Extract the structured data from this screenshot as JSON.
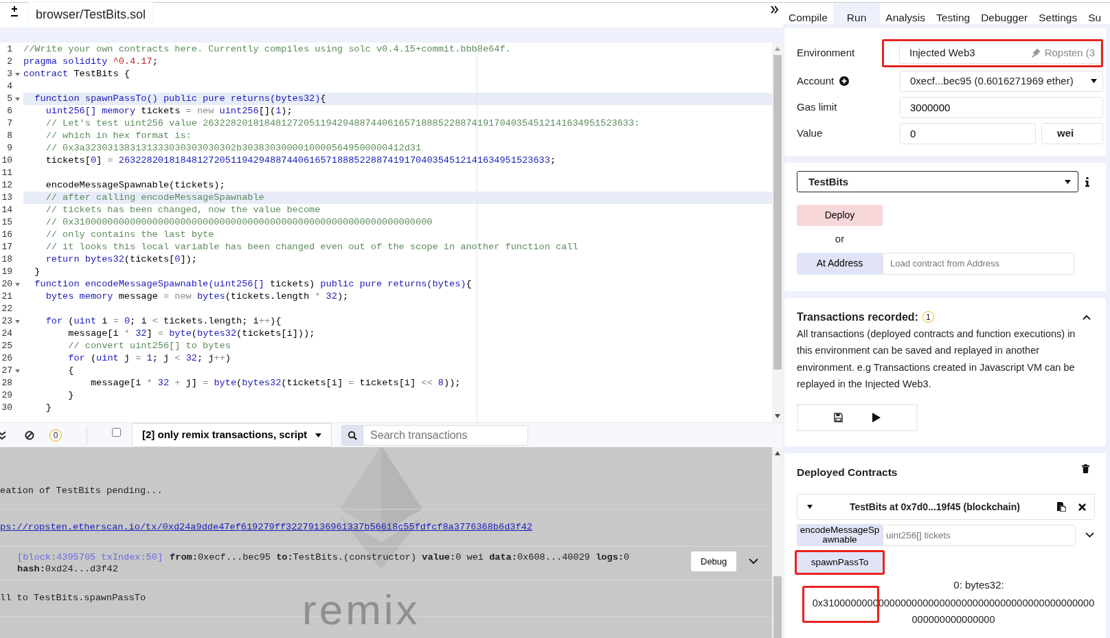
{
  "editor": {
    "tabs": [
      {
        "label": "browser/TestBits.sol",
        "selected": true
      }
    ],
    "lines": [
      {
        "number": "1",
        "fold": false,
        "highlighted": false,
        "tokens": [
          {
            "kind": "comment",
            "t": "//Write your own contracts here. Currently compiles using solc v0.4.15+commit.bbb8e64f."
          }
        ]
      },
      {
        "number": "2",
        "fold": false,
        "highlighted": false,
        "tokens": [
          {
            "kind": "keyword",
            "t": "pragma solidity "
          },
          {
            "kind": "string",
            "t": "^0.4.17"
          },
          {
            "kind": "plain",
            "t": ";"
          }
        ]
      },
      {
        "number": "3",
        "fold": true,
        "highlighted": false,
        "tokens": [
          {
            "kind": "keyword",
            "t": "contract"
          },
          {
            "kind": "plain",
            "t": " TestBits {"
          }
        ]
      },
      {
        "number": "4",
        "fold": false,
        "highlighted": false
      },
      {
        "number": "5",
        "fold": true,
        "highlighted": true,
        "tokens": [
          {
            "kind": "keyword",
            "t": "  function spawnPassTo() public pure returns(bytes32)"
          },
          {
            "kind": "plain",
            "t": "{"
          }
        ]
      },
      {
        "number": "6",
        "fold": false,
        "highlighted": false,
        "tokens": [
          {
            "kind": "keyword",
            "t": "    uint256[] memory"
          },
          {
            "kind": "plain",
            "t": " tickets "
          },
          {
            "kind": "operator",
            "t": "= new "
          },
          {
            "kind": "keyword",
            "t": "uint256"
          },
          {
            "kind": "plain",
            "t": "[]("
          },
          {
            "kind": "number",
            "t": "1"
          },
          {
            "kind": "plain",
            "t": ");"
          }
        ]
      },
      {
        "number": "7",
        "fold": false,
        "highlighted": false,
        "tokens": [
          {
            "kind": "comment",
            "t": "    // Let's test uint256 value 26322820181848127205119429488744061657188852288741917040354512141634951523633:"
          }
        ]
      },
      {
        "number": "8",
        "fold": false,
        "highlighted": false,
        "tokens": [
          {
            "kind": "comment",
            "t": "    // which in hex format is:"
          }
        ]
      },
      {
        "number": "9",
        "fold": false,
        "highlighted": false,
        "tokens": [
          {
            "kind": "comment",
            "t": "    // 0x3a323031383131333030303030302b30383030000100005649500000412d31"
          }
        ]
      },
      {
        "number": "10",
        "fold": false,
        "highlighted": false,
        "tokens": [
          {
            "kind": "plain",
            "t": "    tickets["
          },
          {
            "kind": "number",
            "t": "0"
          },
          {
            "kind": "plain",
            "t": "] "
          },
          {
            "kind": "operator",
            "t": "= "
          },
          {
            "kind": "number",
            "t": "26322820181848127205119429488744061657188852288741917040354512141634951523633"
          },
          {
            "kind": "plain",
            "t": ";"
          }
        ]
      },
      {
        "number": "11",
        "fold": false,
        "highlighted": false
      },
      {
        "number": "12",
        "fold": false,
        "highlighted": false,
        "tokens": [
          {
            "kind": "plain",
            "t": "    encodeMessageSpawnable(tickets);"
          }
        ]
      },
      {
        "number": "13",
        "fold": false,
        "highlighted": true,
        "tokens": [
          {
            "kind": "comment",
            "t": "    // after calling encodeMessageSpawnable"
          }
        ]
      },
      {
        "number": "14",
        "fold": false,
        "highlighted": false,
        "tokens": [
          {
            "kind": "comment",
            "t": "    // tickets has been changed, now the value become"
          }
        ]
      },
      {
        "number": "15",
        "fold": false,
        "highlighted": false,
        "tokens": [
          {
            "kind": "comment",
            "t": "    // 0x3100000000000000000000000000000000000000000000000000000000000000"
          }
        ]
      },
      {
        "number": "16",
        "fold": false,
        "highlighted": false,
        "tokens": [
          {
            "kind": "comment",
            "t": "    // only contains the last byte"
          }
        ]
      },
      {
        "number": "17",
        "fold": false,
        "highlighted": false,
        "tokens": [
          {
            "kind": "comment",
            "t": "    // it looks this local variable has been changed even out of the scope in another function call"
          }
        ]
      },
      {
        "number": "18",
        "fold": false,
        "highlighted": false,
        "tokens": [
          {
            "kind": "keyword",
            "t": "    return bytes32"
          },
          {
            "kind": "plain",
            "t": "(tickets["
          },
          {
            "kind": "number",
            "t": "0"
          },
          {
            "kind": "plain",
            "t": "]);"
          }
        ]
      },
      {
        "number": "19",
        "fold": false,
        "highlighted": false,
        "tokens": [
          {
            "kind": "plain",
            "t": "  }"
          }
        ]
      },
      {
        "number": "20",
        "fold": true,
        "highlighted": false,
        "tokens": [
          {
            "kind": "keyword",
            "t": "  function encodeMessageSpawnable(uint256[]"
          },
          {
            "kind": "plain",
            "t": " tickets) "
          },
          {
            "kind": "keyword",
            "t": "public pure returns(bytes)"
          },
          {
            "kind": "plain",
            "t": "{"
          }
        ]
      },
      {
        "number": "21",
        "fold": false,
        "highlighted": false,
        "tokens": [
          {
            "kind": "keyword",
            "t": "    bytes memory"
          },
          {
            "kind": "plain",
            "t": " message "
          },
          {
            "kind": "operator",
            "t": "= new "
          },
          {
            "kind": "keyword",
            "t": "bytes"
          },
          {
            "kind": "plain",
            "t": "(tickets.length "
          },
          {
            "kind": "operator",
            "t": "* "
          },
          {
            "kind": "number",
            "t": "32"
          },
          {
            "kind": "plain",
            "t": ");"
          }
        ]
      },
      {
        "number": "22",
        "fold": false,
        "highlighted": false
      },
      {
        "number": "23",
        "fold": true,
        "highlighted": false,
        "tokens": [
          {
            "kind": "keyword",
            "t": "    for"
          },
          {
            "kind": "plain",
            "t": " ("
          },
          {
            "kind": "keyword",
            "t": "uint"
          },
          {
            "kind": "plain",
            "t": " i "
          },
          {
            "kind": "operator",
            "t": "= "
          },
          {
            "kind": "number",
            "t": "0"
          },
          {
            "kind": "plain",
            "t": "; i "
          },
          {
            "kind": "operator",
            "t": "< "
          },
          {
            "kind": "plain",
            "t": "tickets.length; i"
          },
          {
            "kind": "operator",
            "t": "++"
          },
          {
            "kind": "plain",
            "t": "){"
          }
        ]
      },
      {
        "number": "24",
        "fold": false,
        "highlighted": false,
        "tokens": [
          {
            "kind": "plain",
            "t": "        message[i "
          },
          {
            "kind": "operator",
            "t": "* "
          },
          {
            "kind": "number",
            "t": "32"
          },
          {
            "kind": "plain",
            "t": "] "
          },
          {
            "kind": "operator",
            "t": "= "
          },
          {
            "kind": "keyword",
            "t": "byte"
          },
          {
            "kind": "plain",
            "t": "("
          },
          {
            "kind": "keyword",
            "t": "bytes32"
          },
          {
            "kind": "plain",
            "t": "(tickets[i]));"
          }
        ]
      },
      {
        "number": "25",
        "fold": false,
        "highlighted": false,
        "tokens": [
          {
            "kind": "comment",
            "t": "        // convert uint256[] to bytes"
          }
        ]
      },
      {
        "number": "26",
        "fold": false,
        "highlighted": false,
        "tokens": [
          {
            "kind": "keyword",
            "t": "        for"
          },
          {
            "kind": "plain",
            "t": " ("
          },
          {
            "kind": "keyword",
            "t": "uint"
          },
          {
            "kind": "plain",
            "t": " j "
          },
          {
            "kind": "operator",
            "t": "= "
          },
          {
            "kind": "number",
            "t": "1"
          },
          {
            "kind": "plain",
            "t": "; j "
          },
          {
            "kind": "operator",
            "t": "< "
          },
          {
            "kind": "number",
            "t": "32"
          },
          {
            "kind": "plain",
            "t": "; j"
          },
          {
            "kind": "operator",
            "t": "++"
          },
          {
            "kind": "plain",
            "t": ")"
          }
        ]
      },
      {
        "number": "27",
        "fold": true,
        "highlighted": false,
        "tokens": [
          {
            "kind": "plain",
            "t": "        {"
          }
        ]
      },
      {
        "number": "28",
        "fold": false,
        "highlighted": false,
        "tokens": [
          {
            "kind": "plain",
            "t": "            message[i "
          },
          {
            "kind": "operator",
            "t": "* "
          },
          {
            "kind": "number",
            "t": "32"
          },
          {
            "kind": "operator",
            "t": " + "
          },
          {
            "kind": "plain",
            "t": "j] "
          },
          {
            "kind": "operator",
            "t": "= "
          },
          {
            "kind": "keyword",
            "t": "byte"
          },
          {
            "kind": "plain",
            "t": "("
          },
          {
            "kind": "keyword",
            "t": "bytes32"
          },
          {
            "kind": "plain",
            "t": "(tickets[i] "
          },
          {
            "kind": "operator",
            "t": "= "
          },
          {
            "kind": "plain",
            "t": "tickets[i] "
          },
          {
            "kind": "operator",
            "t": "<< "
          },
          {
            "kind": "number",
            "t": "8"
          },
          {
            "kind": "plain",
            "t": "));"
          }
        ]
      },
      {
        "number": "29",
        "fold": false,
        "highlighted": false,
        "tokens": [
          {
            "kind": "plain",
            "t": "        }"
          }
        ]
      },
      {
        "number": "30",
        "fold": false,
        "highlighted": false,
        "tokens": [
          {
            "kind": "plain",
            "t": "    }"
          }
        ]
      }
    ]
  },
  "terminal": {
    "pending_count": "0",
    "checkbox": {
      "checked": false
    },
    "filter": "[2] only remix transactions, script",
    "search": {
      "placeholder": "Search transactions"
    },
    "watermark": "remix",
    "logs": [
      {
        "kind": "text",
        "text": "eation of TestBits pending..."
      },
      {
        "kind": "link",
        "text": "ps://ropsten.etherscan.io/tx/0xd24a9dde47ef619279ff32279136961337b56618c55fdfcf8a3776368b6d3f42"
      },
      {
        "kind": "tx",
        "block": "[block:4395705 txIndex:50]",
        "details": "**from:**0xecf...bec95 **to:**TestBits.(constructor) **value:**0 wei **data:**0x608...40029 **logs:**0 **hash:**0xd24...d3f42",
        "button": "Debug"
      },
      {
        "kind": "text",
        "text": "ll to TestBits.spawnPassTo"
      }
    ]
  },
  "run_panel": {
    "tabs": [
      {
        "label": "Compile",
        "selected": false
      },
      {
        "label": "Run",
        "selected": true
      },
      {
        "label": "Analysis",
        "selected": false
      },
      {
        "label": "Testing",
        "selected": false
      },
      {
        "label": "Debugger",
        "selected": false
      },
      {
        "label": "Settings",
        "selected": false
      },
      {
        "label": "Su",
        "selected": false
      }
    ],
    "environment": {
      "label": "Environment",
      "value": "Injected Web3",
      "network": "Ropsten (3",
      "annotated": true
    },
    "account": {
      "label": "Account",
      "value": "0xecf...bec95 (0.6016271969 ether)"
    },
    "gas_limit": {
      "label": "Gas limit",
      "value": "3000000"
    },
    "value": {
      "label": "Value",
      "value": "0",
      "unit": "wei"
    },
    "contract_select": "TestBits",
    "deploy_button": "Deploy",
    "or_text": "or",
    "at_address_button": "At Address",
    "address_placeholder": "Load contract from Address",
    "transactions": {
      "title": "Transactions recorded:",
      "count": "1",
      "expanded": true,
      "description": "All transactions (deployed contracts and function executions) in this environment can be saved and replayed in another environment. e.g Transactions created in Javascript VM can be replayed in the Injected Web3."
    },
    "deployed": {
      "title": "Deployed Contracts",
      "instances": [
        {
          "title": "TestBits at 0x7d0...19f45 (blockchain)",
          "expanded": true,
          "functions": [
            {
              "name": "encodeMessageSpawnable",
              "placeholder": "uint256[] tickets",
              "annotated": false
            },
            {
              "name": "spawnPassTo",
              "annotated": true
            }
          ],
          "output": {
            "label": "0: bytes32:",
            "value": "0x3100000000000000000000000000000000000000000000000000000000000000",
            "annotated": true
          }
        }
      ]
    }
  }
}
